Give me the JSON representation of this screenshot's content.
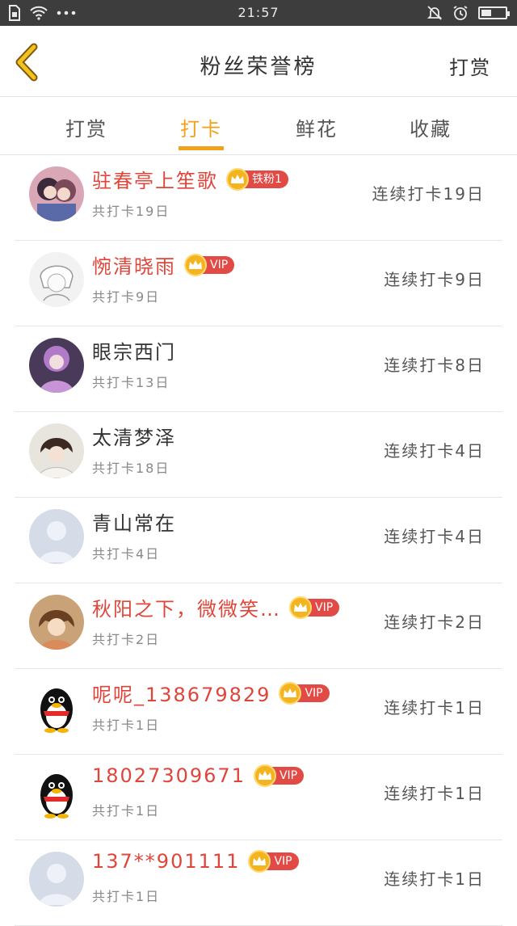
{
  "status_bar": {
    "time": "21:57",
    "icons": [
      "sim-card-icon",
      "wifi-icon",
      "more-dots-icon",
      "mute-bell-icon",
      "alarm-icon",
      "battery-icon"
    ]
  },
  "header": {
    "title": "粉丝荣誉榜",
    "right_action": "打赏"
  },
  "tabs": [
    {
      "label": "打赏"
    },
    {
      "label": "打卡"
    },
    {
      "label": "鲜花"
    },
    {
      "label": "收藏"
    }
  ],
  "active_tab": "打卡",
  "colors": {
    "accent": "#f1a11a",
    "vip_red": "#e24a45",
    "name_red": "#e0453a",
    "crown_gold": "#f4b41f"
  },
  "rows": [
    {
      "name": "驻春亭上笙歌",
      "badge": "铁粉1",
      "sub": "共打卡19日",
      "right": "连续打卡19日"
    },
    {
      "name": "惋清晓雨",
      "badge": "VIP",
      "sub": "共打卡9日",
      "right": "连续打卡9日"
    },
    {
      "name": "眼宗西门",
      "badge": "",
      "sub": "共打卡13日",
      "right": "连续打卡8日"
    },
    {
      "name": "太清梦泽",
      "badge": "",
      "sub": "共打卡18日",
      "right": "连续打卡4日"
    },
    {
      "name": "青山常在",
      "badge": "",
      "sub": "共打卡4日",
      "right": "连续打卡4日"
    },
    {
      "name": "秋阳之下，微微笑…",
      "badge": "VIP",
      "sub": "共打卡2日",
      "right": "连续打卡2日"
    },
    {
      "name": "呢呢_138679829",
      "badge": "VIP",
      "sub": "共打卡1日",
      "right": "连续打卡1日"
    },
    {
      "name": "18027309671",
      "badge": "VIP",
      "sub": "共打卡1日",
      "right": "连续打卡1日"
    },
    {
      "name": "137**901111",
      "badge": "VIP",
      "sub": "共打卡1日",
      "right": "连续打卡1日"
    }
  ]
}
